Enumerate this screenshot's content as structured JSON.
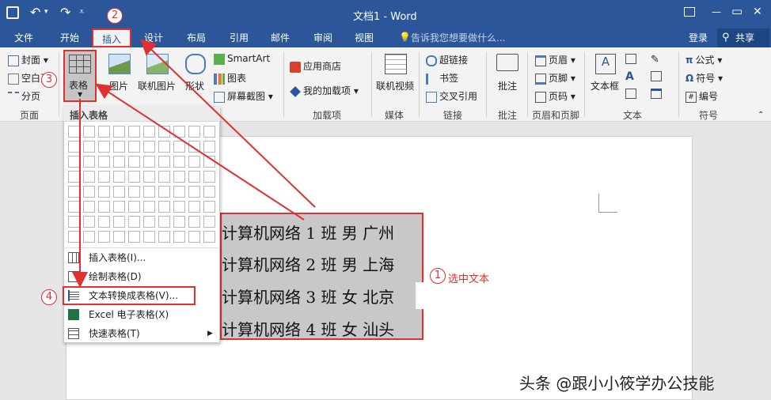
{
  "titlebar": {
    "title": "文档1 - Word",
    "min": "—",
    "restore": "▭",
    "close": "✕"
  },
  "tabs": [
    "文件",
    "开始",
    "插入",
    "设计",
    "布局",
    "引用",
    "邮件",
    "审阅",
    "视图"
  ],
  "tell_me": "告诉我您想要做什么...",
  "account": {
    "login": "登录",
    "share": "共享"
  },
  "ribbon": {
    "pages_group": {
      "cover": "封面",
      "blank": "空白页",
      "break": "分页",
      "label": "页面"
    },
    "table": {
      "label": "表格"
    },
    "illustrations": {
      "picture": "图片",
      "online_picture": "联机图片",
      "shapes": "形状",
      "smartart": "SmartArt",
      "chart": "图表",
      "screenshot": "屏幕截图"
    },
    "addins": {
      "store": "应用商店",
      "my_addins": "我的加载项",
      "label": "加载项"
    },
    "media": {
      "online_video": "联机视频",
      "label": "媒体"
    },
    "links": {
      "hyperlink": "超链接",
      "bookmark": "书签",
      "crossref": "交叉引用",
      "label": "链接"
    },
    "comments": {
      "comment": "批注",
      "label": "批注"
    },
    "header_footer": {
      "header": "页眉",
      "footer": "页脚",
      "page_number": "页码",
      "label": "页眉和页脚"
    },
    "text": {
      "textbox": "文本框",
      "label": "文本"
    },
    "symbols": {
      "equation": "公式",
      "symbol": "符号",
      "number": "编号",
      "label": "符号"
    }
  },
  "dropdown": {
    "title": "插入表格",
    "items": [
      "插入表格(I)...",
      "绘制表格(D)",
      "文本转换成表格(V)...",
      "Excel 电子表格(X)",
      "快速表格(T)"
    ]
  },
  "document_lines": [
    "计算机网络 1 班  男   广州",
    " 计算机网络 2 班  男  上海",
    "计算机网络 3 班  女  北京",
    "计算机网络 4 班   女  汕头"
  ],
  "annotations": {
    "n1": "1",
    "n1_text": "选中文本",
    "n2": "2",
    "n3": "3",
    "n4": "4"
  },
  "watermark": "头条 @跟小小筱学办公技能",
  "colors": {
    "title_bar": "#2b579a",
    "annotation_red": "#e03030",
    "selection_gray": "#c8c8c8"
  }
}
